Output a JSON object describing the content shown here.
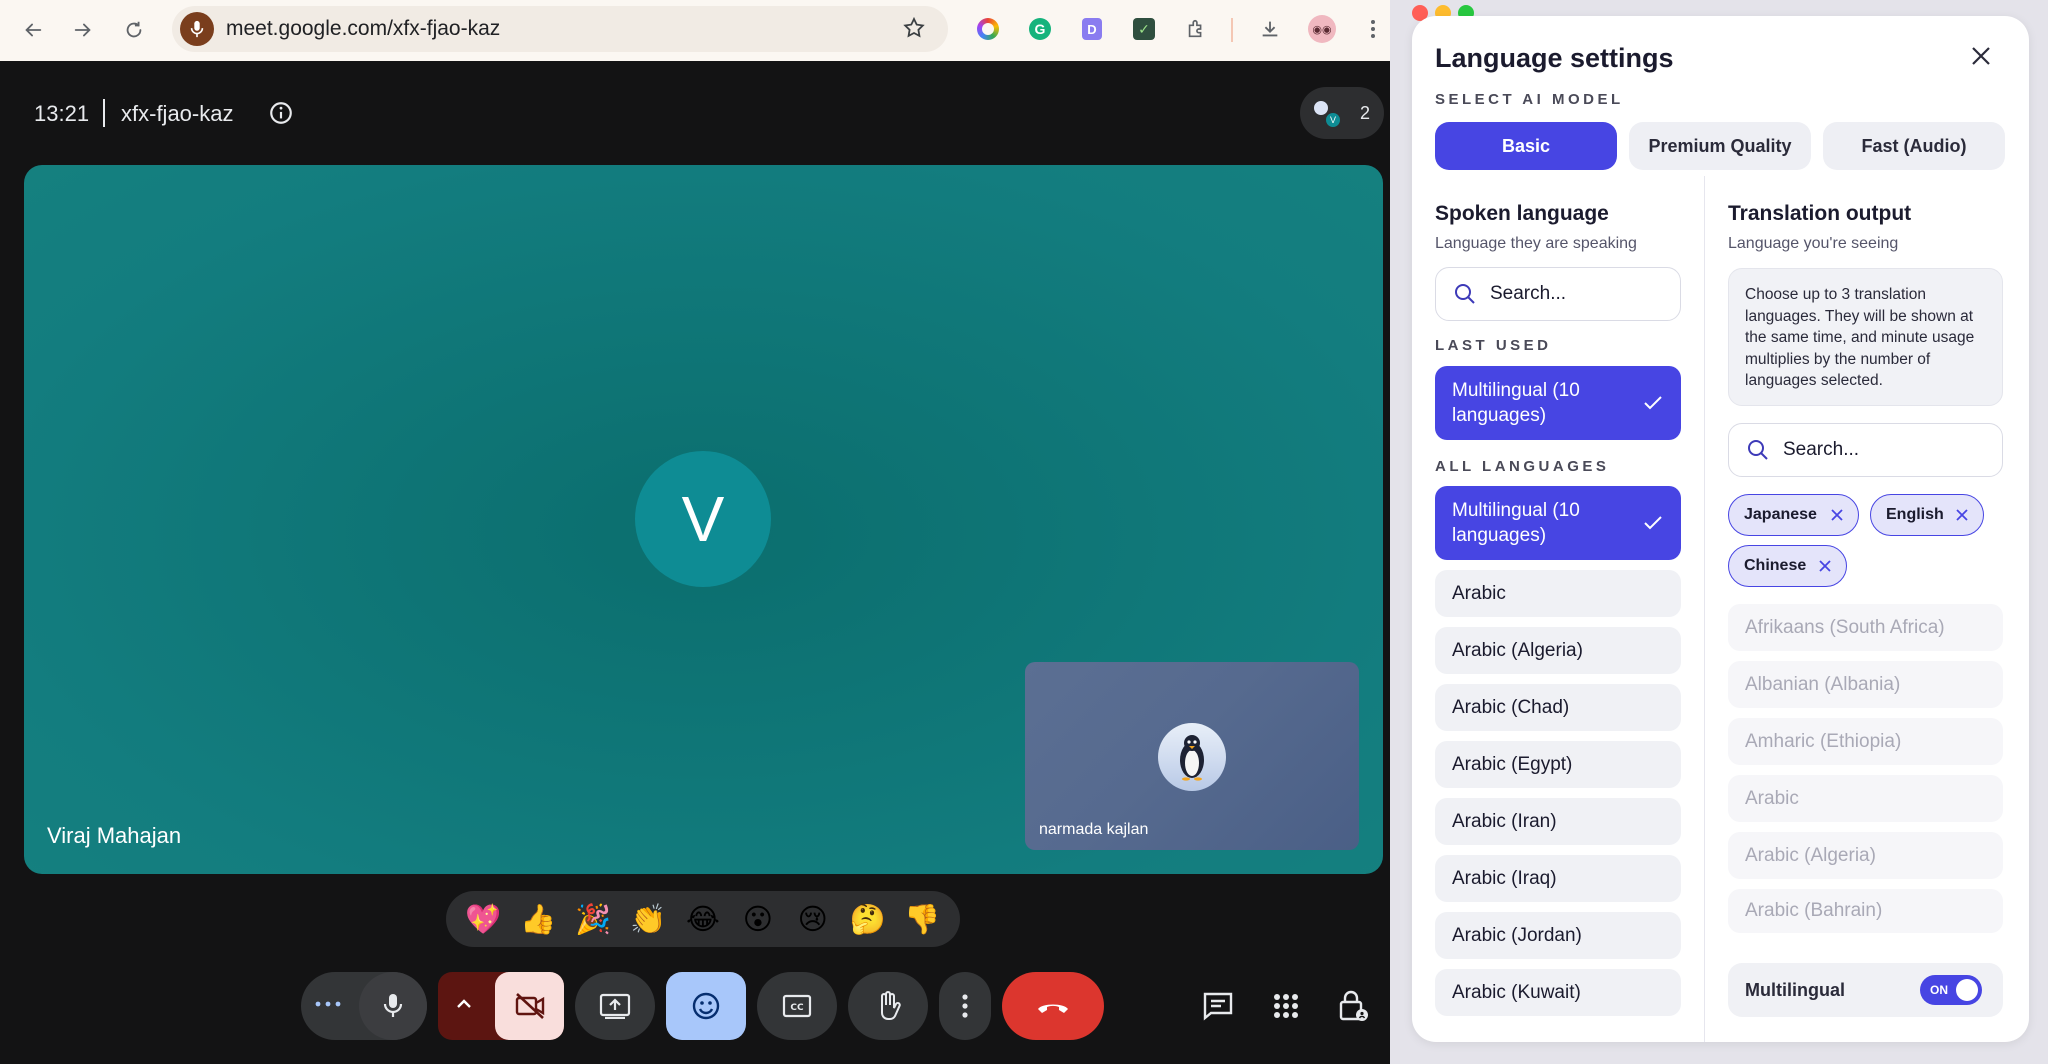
{
  "browser": {
    "url": "meet.google.com/xfx-fjao-kaz",
    "icons": [
      "back-icon",
      "forward-icon",
      "reload-icon",
      "microphone-icon",
      "bookmark-star-icon",
      "extensions-icon",
      "download-icon",
      "more-vert-icon"
    ]
  },
  "meet": {
    "time": "13:21",
    "meeting_code": "xfx-fjao-kaz",
    "participant_count": "2",
    "main_participant": {
      "initial": "V",
      "name": "Viraj Mahajan"
    },
    "self_participant": {
      "name": "narmada kajlan"
    },
    "reactions": [
      "💖",
      "👍",
      "🎉",
      "👏",
      "😂",
      "😮",
      "😢",
      "🤔",
      "👎"
    ],
    "controls": [
      "more-options",
      "microphone",
      "video-options",
      "camera-off",
      "present-screen",
      "emoji",
      "captions",
      "raise-hand",
      "more-actions",
      "leave-call",
      "chat",
      "activities",
      "host-controls"
    ],
    "colors": {
      "tile": "#137d7f",
      "avatar": "#0e8c94",
      "leave": "#ea4335",
      "camera_off": "#f9dedc"
    }
  },
  "panel": {
    "title": "Language settings",
    "model_caption": "SELECT AI MODEL",
    "models": [
      {
        "label": "Basic",
        "active": true
      },
      {
        "label": "Premium Quality",
        "active": false
      },
      {
        "label": "Fast (Audio)",
        "active": false
      }
    ],
    "spoken": {
      "title": "Spoken language",
      "subtitle": "Language they are speaking",
      "search_placeholder": "Search...",
      "last_used_caption": "LAST USED",
      "last_used": "Multilingual (10 languages)",
      "all_caption": "ALL LANGUAGES",
      "languages": [
        "Multilingual (10 languages)",
        "Arabic",
        "Arabic (Algeria)",
        "Arabic (Chad)",
        "Arabic (Egypt)",
        "Arabic (Iran)",
        "Arabic (Iraq)",
        "Arabic (Jordan)",
        "Arabic (Kuwait)"
      ]
    },
    "output": {
      "title": "Translation output",
      "subtitle": "Language you're seeing",
      "info": "Choose up to 3 translation languages. They will be shown at the same time, and minute usage multiplies by the number of languages selected.",
      "search_placeholder": "Search...",
      "chips": [
        "Japanese",
        "English",
        "Chinese"
      ],
      "languages": [
        "Afrikaans (South Africa)",
        "Albanian (Albania)",
        "Amharic (Ethiopia)",
        "Arabic",
        "Arabic (Algeria)",
        "Arabic (Bahrain)"
      ],
      "multilingual_label": "Multilingual",
      "toggle_state": "ON"
    },
    "colors": {
      "accent": "#4745e3",
      "chip_bg": "#e4e4fa"
    }
  }
}
